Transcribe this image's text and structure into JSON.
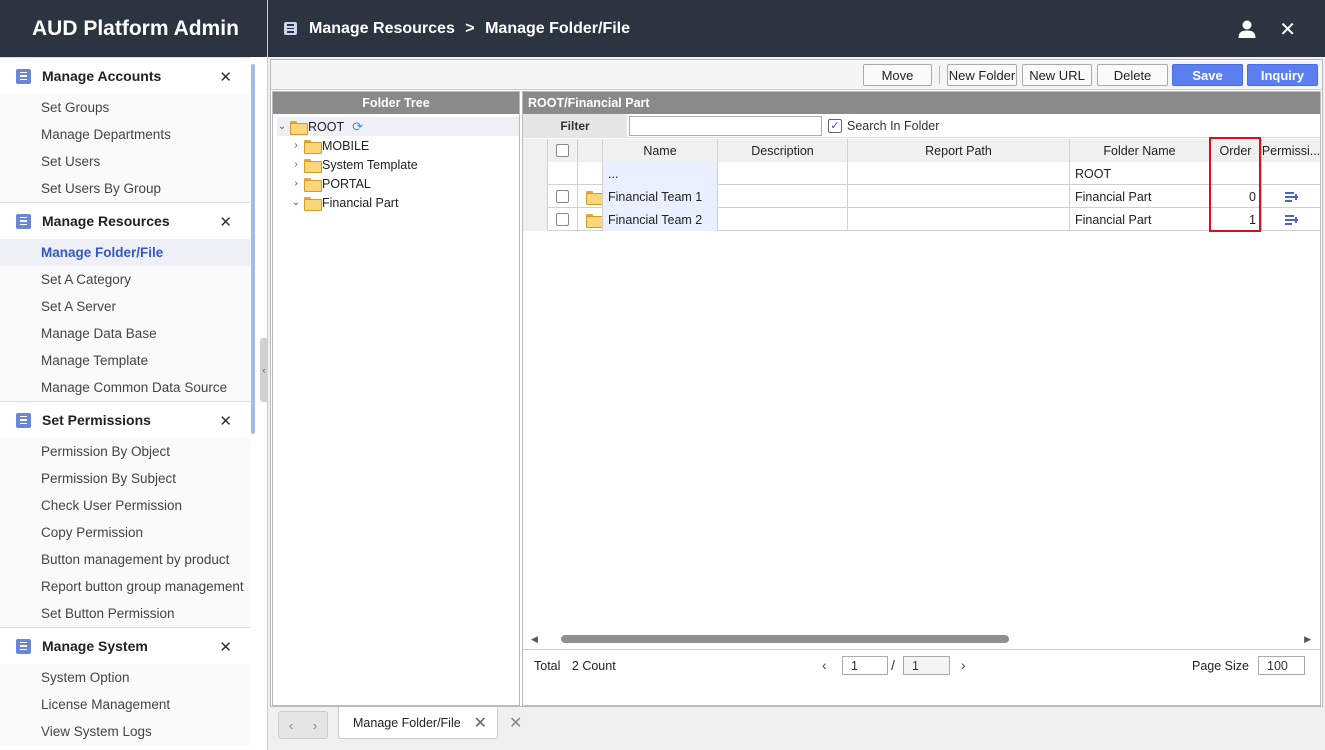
{
  "app": {
    "title": "AUD Platform Admin"
  },
  "header": {
    "section": "Manage Resources",
    "separator": ">",
    "page": "Manage Folder/File",
    "user_icon": "user-icon",
    "close_glyph": "✕"
  },
  "sidebar": {
    "groups": [
      {
        "title": "Manage Accounts",
        "close": "✕",
        "items": [
          "Set Groups",
          "Manage Departments",
          "Set Users",
          "Set Users By Group"
        ]
      },
      {
        "title": "Manage Resources",
        "close": "✕",
        "items": [
          "Manage Folder/File",
          "Set A Category",
          "Set A Server",
          "Manage Data Base",
          "Manage Template",
          "Manage Common Data Source"
        ]
      },
      {
        "title": "Set Permissions",
        "close": "✕",
        "items": [
          "Permission By Object",
          "Permission By Subject",
          "Check User Permission",
          "Copy Permission",
          "Button management by product",
          "Report button group management",
          "Set Button Permission"
        ]
      },
      {
        "title": "Manage System",
        "close": "✕",
        "items": [
          "System Option",
          "License Management",
          "View System Logs"
        ]
      }
    ],
    "active_item": "Manage Folder/File"
  },
  "toolbar": {
    "move": "Move",
    "new_folder": "New Folder",
    "new_url": "New URL",
    "delete": "Delete",
    "save": "Save",
    "inquiry": "Inquiry"
  },
  "tree": {
    "header": "Folder Tree",
    "root": {
      "label": "ROOT",
      "expanded": true
    },
    "children": [
      {
        "label": "MOBILE",
        "expanded": false
      },
      {
        "label": "System Template",
        "expanded": false
      },
      {
        "label": "PORTAL",
        "expanded": false
      },
      {
        "label": "Financial Part",
        "expanded": true
      }
    ]
  },
  "grid": {
    "path": "ROOT/Financial Part",
    "filter_label": "Filter",
    "filter_value": "",
    "search_in_folder_label": "Search In Folder",
    "search_in_folder_checked": true,
    "columns": [
      "Name",
      "Description",
      "Report Path",
      "Folder Name",
      "Order",
      "Permissi..."
    ],
    "rows": [
      {
        "name": "...",
        "description": "",
        "report_path": "",
        "folder_name": "ROOT",
        "order": "",
        "checkbox": false,
        "is_parent": true
      },
      {
        "name": "Financial Team 1",
        "description": "",
        "report_path": "",
        "folder_name": "Financial Part",
        "order": "0",
        "checkbox": true,
        "is_parent": false
      },
      {
        "name": "Financial Team 2",
        "description": "",
        "report_path": "",
        "folder_name": "Financial Part",
        "order": "1",
        "checkbox": true,
        "is_parent": false
      }
    ],
    "highlight_column": "Order",
    "highlight_color": "#d9101a"
  },
  "pager": {
    "total_label": "Total",
    "count": "2",
    "count_label": "Count",
    "current_page": "1",
    "slash": "/",
    "total_pages": "1",
    "page_size_label": "Page Size",
    "page_size": "100"
  },
  "tabs": {
    "active": "Manage Folder/File"
  },
  "colors": {
    "header_bg": "#2c3440",
    "accent": "#5b7ef0",
    "active_link": "#3356c9"
  }
}
